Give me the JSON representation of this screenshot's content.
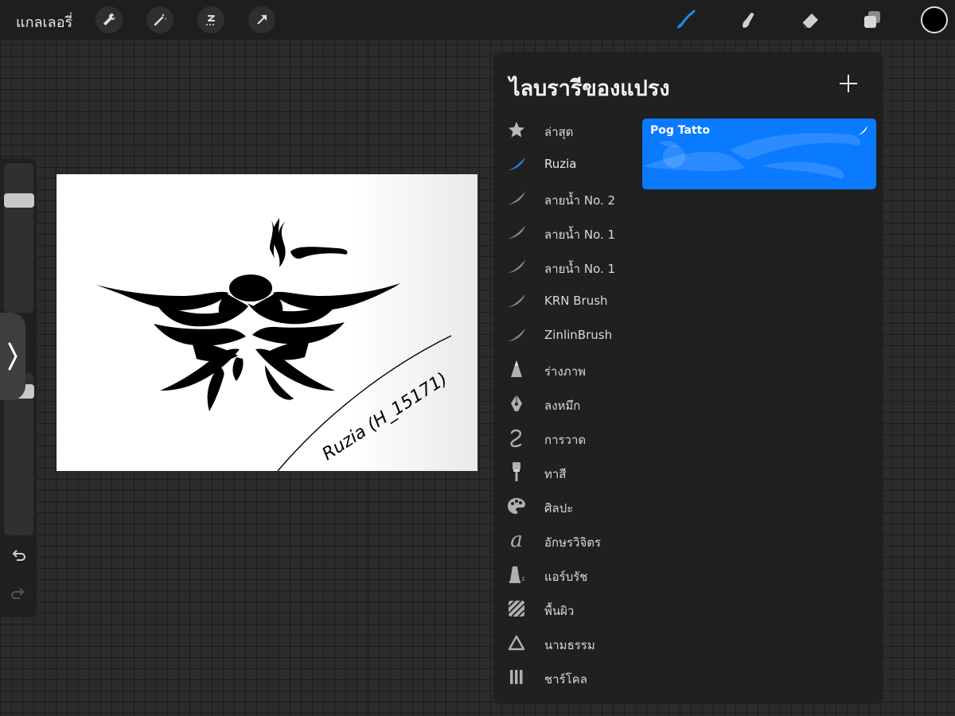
{
  "topbar": {
    "gallery_label": "แกลเลอรี่",
    "tools": [
      "wrench-icon",
      "magic-wand-icon",
      "selection-icon",
      "transform-arrow-icon"
    ],
    "right_tools": [
      "brush-icon",
      "smudge-icon",
      "eraser-icon",
      "layers-icon"
    ],
    "active_tool": "brush-icon",
    "current_color": "#000000"
  },
  "sidebar": {
    "tools": [
      "brush-size-slider",
      "modify-button",
      "opacity-slider",
      "undo-icon",
      "redo-icon"
    ]
  },
  "canvas": {
    "signature_text": "Ruzia (H_15171)"
  },
  "brush_library": {
    "title": "ไลบรารีของแปรง",
    "add_icon": "plus-icon",
    "categories": [
      {
        "label": "ล่าสุด",
        "icon": "star-icon"
      },
      {
        "label": "Ruzia",
        "icon": "brush-stroke-icon",
        "selected": true
      },
      {
        "label": "ลายน้ำ No. 2",
        "icon": "brush-stroke-icon"
      },
      {
        "label": "ลายน้ำ No. 1",
        "icon": "brush-stroke-icon"
      },
      {
        "label": "ลายน้ำ No. 1",
        "icon": "brush-stroke-icon"
      },
      {
        "label": "KRN Brush",
        "icon": "brush-stroke-icon"
      },
      {
        "label": "ZinlinBrush",
        "icon": "brush-stroke-icon"
      },
      {
        "label": "ร่างภาพ",
        "icon": "pencil-tip-icon"
      },
      {
        "label": "ลงหมึก",
        "icon": "pen-nib-icon"
      },
      {
        "label": "การวาด",
        "icon": "squiggle-icon"
      },
      {
        "label": "ทาสี",
        "icon": "paint-brush-icon"
      },
      {
        "label": "ศิลปะ",
        "icon": "palette-icon"
      },
      {
        "label": "อักษรวิจิตร",
        "icon": "calligraphy-icon"
      },
      {
        "label": "แอร์บรัช",
        "icon": "airbrush-icon"
      },
      {
        "label": "พื้นผิว",
        "icon": "texture-icon"
      },
      {
        "label": "นามธรรม",
        "icon": "triangle-icon"
      },
      {
        "label": "ชาร์โคล",
        "icon": "charcoal-icon"
      }
    ],
    "brushes": [
      {
        "name": "Pog Tatto",
        "selected": true
      }
    ],
    "accent_color": "#0a7aff"
  }
}
